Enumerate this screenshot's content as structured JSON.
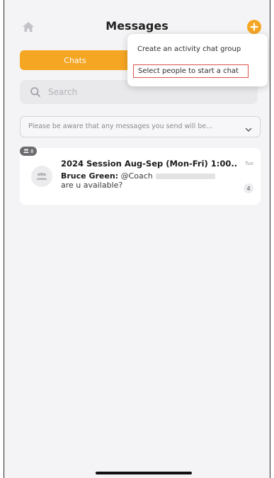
{
  "header": {
    "title": "Messages",
    "home_icon": "home-icon",
    "add_icon": "plus-icon"
  },
  "tabs": {
    "chats_label": "Chats"
  },
  "search": {
    "placeholder": "Search"
  },
  "notice": {
    "text": "Please be aware that any messages you send will be..."
  },
  "chats": [
    {
      "member_count": "8",
      "title": "2024 Session Aug-Sep (Mon-Fri) 1:00...",
      "time": "Tue",
      "sender": "Bruce Green:",
      "mention": "@Coach",
      "message": "are u available?",
      "unread": "4"
    }
  ],
  "menu": {
    "create_group": "Create an activity chat group",
    "select_people": "Select people to start a chat"
  },
  "colors": {
    "accent": "#f5a623",
    "highlight_border": "#d9534f",
    "background": "#f4f4f6"
  }
}
